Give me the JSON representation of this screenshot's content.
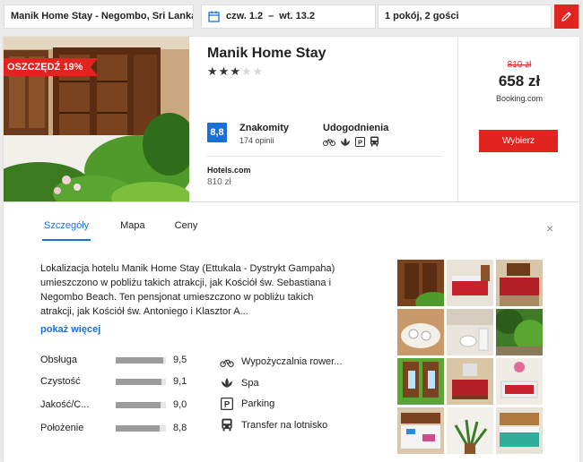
{
  "search": {
    "destination": "Manik Home Stay - Negombo, Sri Lanka",
    "date_from": "czw. 1.2",
    "date_sep": "–",
    "date_to": "wt. 13.2",
    "guests": "1 pokój, 2 gości"
  },
  "hotel": {
    "name": "Manik Home Stay",
    "stars": 3,
    "stars_max": 5,
    "discount_badge": "OSZCZĘDŹ 19%",
    "score": "8,8",
    "score_label": "Znakomity",
    "reviews": "174 opinii",
    "amenities_title": "Udogodnienia",
    "provider_name": "Hotels.com",
    "provider_price": "810 zł",
    "old_price": "810 zł",
    "price": "658 zł",
    "best_provider": "Booking.com",
    "select_label": "Wybierz"
  },
  "details": {
    "tabs": [
      "Szczegóły",
      "Mapa",
      "Ceny"
    ],
    "active_tab": 0,
    "close": "×",
    "description": "Lokalizacja hotelu Manik Home Stay (Ettukala - Dystrykt Gampaha) umieszczono w pobliżu takich atrakcji, jak Kościół św. Sebastiana i Negombo Beach. Ten pensjonat umieszczono w pobliżu takich atrakcji, jak Kościół św. Antoniego i Klasztor A...",
    "more_label": "pokaż więcej",
    "ratings": [
      {
        "label": "Obsługa",
        "value": "9,5",
        "fraction": 0.95
      },
      {
        "label": "Czystość",
        "value": "9,1",
        "fraction": 0.91
      },
      {
        "label": "Jakość/C...",
        "value": "9,0",
        "fraction": 0.9
      },
      {
        "label": "Położenie",
        "value": "8,8",
        "fraction": 0.88
      }
    ],
    "amenities": [
      {
        "icon": "bicycle-icon",
        "label": "Wypożyczalnia rower..."
      },
      {
        "icon": "spa-icon",
        "label": "Spa"
      },
      {
        "icon": "parking-icon",
        "label": "Parking"
      },
      {
        "icon": "bus-icon",
        "label": "Transfer na lotnisko"
      }
    ],
    "gallery_count": 12
  },
  "colors": {
    "accent": "#e0241f",
    "link": "#1a6fd6",
    "score_badge": "#1a6fd6"
  }
}
